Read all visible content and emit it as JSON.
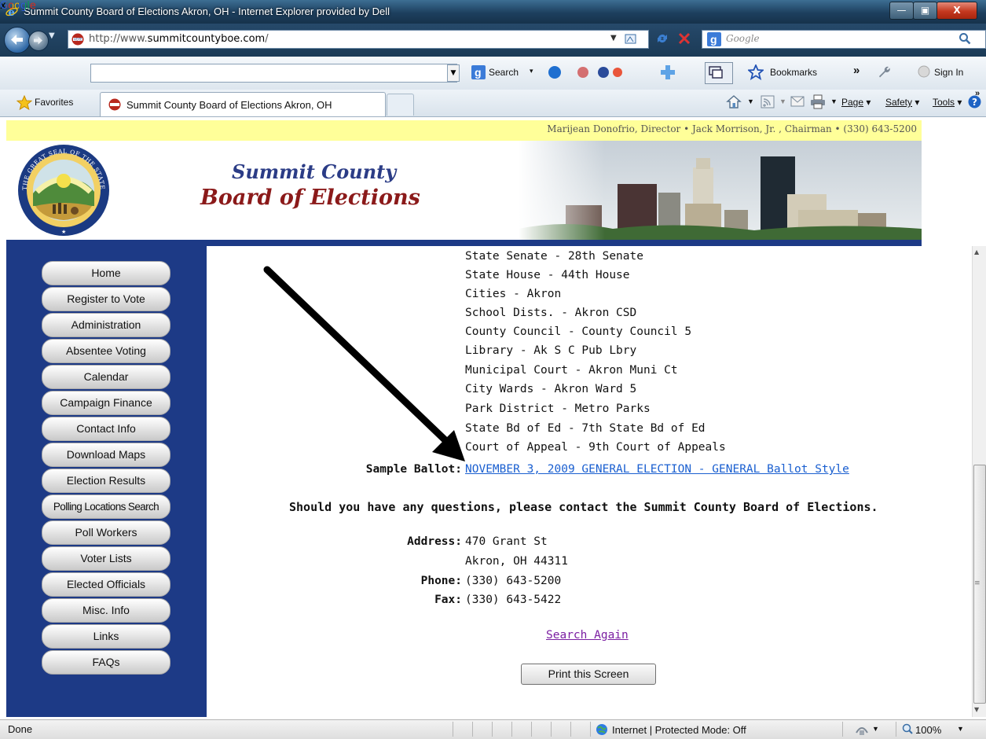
{
  "window": {
    "title": "Summit County Board of Elections Akron, OH - Internet Explorer provided by Dell",
    "controls": {
      "minimize": "—",
      "maximize": "▣",
      "close": "X"
    }
  },
  "addressbar": {
    "url_prefix": "http://www.",
    "url_host": "summitcountyboe.com",
    "url_suffix": "/",
    "search_placeholder": "Google"
  },
  "google_toolbar": {
    "close": "x",
    "logo": "Google",
    "search_label": "Search",
    "bookmarks_label": "Bookmarks",
    "more": "»",
    "signin_label": "Sign In"
  },
  "favorites_bar": {
    "favorites_label": "Favorites",
    "tab_title": "Summit County Board of Elections Akron, OH",
    "commands": {
      "page": "Page",
      "safety": "Safety",
      "tools": "Tools"
    },
    "more": "»"
  },
  "site": {
    "contact_line": "Marijean Donofrio, Director • Jack Morrison, Jr. , Chairman • (330) 643-5200",
    "brand_line1": "Summit County",
    "brand_line2": "Board of Elections",
    "seal_text": "THE GREAT SEAL OF THE STATE OF OHIO"
  },
  "nav": {
    "items": [
      "Home",
      "Register to Vote",
      "Administration",
      "Absentee Voting",
      "Calendar",
      "Campaign Finance",
      "Contact Info",
      "Download Maps",
      "Election Results",
      "Polling Locations Search",
      "Poll Workers",
      "Voter Lists",
      "Elected Officials",
      "Misc. Info",
      "Links",
      "FAQs"
    ]
  },
  "districts": [
    "State Senate - 28th Senate",
    "State House - 44th House",
    "Cities - Akron",
    "School Dists. - Akron CSD",
    "County Council - County Council 5",
    "Library - Ak S C Pub Lbry",
    "Municipal Court - Akron Muni Ct",
    "City Wards - Akron Ward 5",
    "Park District - Metro Parks",
    "State Bd of Ed - 7th State Bd of Ed",
    "Court of Appeal - 9th Court of Appeals"
  ],
  "sample_ballot": {
    "label": "Sample Ballot:",
    "link": "NOVEMBER 3, 2009 GENERAL ELECTION - GENERAL Ballot Style"
  },
  "question": "Should you have any questions, please contact the Summit County Board of Elections.",
  "contact": {
    "address_label": "Address:",
    "address_line1": "470 Grant St",
    "address_line2": "Akron, OH 44311",
    "phone_label": "Phone:",
    "phone": "(330) 643-5200",
    "fax_label": "Fax:",
    "fax": "(330) 643-5422"
  },
  "search_again": "Search Again",
  "print_button": "Print this Screen",
  "statusbar": {
    "status": "Done",
    "zone": "Internet | Protected Mode: Off",
    "zoom": "100%"
  }
}
